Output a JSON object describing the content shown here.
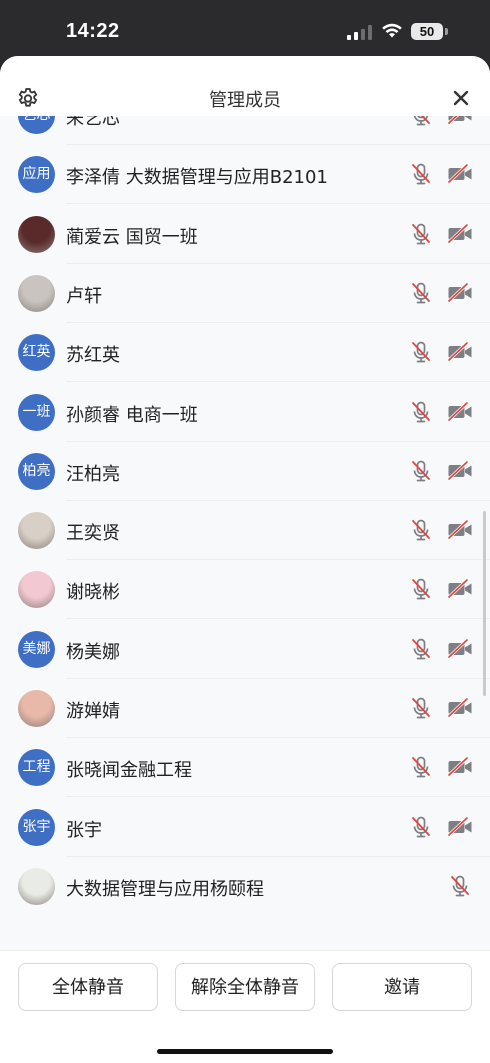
{
  "status_bar": {
    "time": "14:22",
    "battery": "50"
  },
  "header": {
    "title": "管理成员"
  },
  "members": [
    {
      "avatar_text": "艺芯",
      "name": "来艺芯",
      "avatar_type": "text",
      "avatar_color": "#3f6fc4"
    },
    {
      "avatar_text": "应用",
      "name": "李泽倩 大数据管理与应用B2101",
      "avatar_type": "text",
      "avatar_color": "#3f6fc4"
    },
    {
      "avatar_text": "",
      "name": "蔺爱云 国贸一班",
      "avatar_type": "photo",
      "avatar_color": "#5a2a2a"
    },
    {
      "avatar_text": "",
      "name": "卢轩",
      "avatar_type": "photo",
      "avatar_color": "#c9c4bf"
    },
    {
      "avatar_text": "红英",
      "name": "苏红英",
      "avatar_type": "text",
      "avatar_color": "#3f6fc4"
    },
    {
      "avatar_text": "一班",
      "name": "孙颜睿 电商一班",
      "avatar_type": "text",
      "avatar_color": "#3f6fc4"
    },
    {
      "avatar_text": "柏亮",
      "name": "汪柏亮",
      "avatar_type": "text",
      "avatar_color": "#3f6fc4"
    },
    {
      "avatar_text": "",
      "name": "王奕贤",
      "avatar_type": "photo",
      "avatar_color": "#d8cfc6"
    },
    {
      "avatar_text": "",
      "name": "谢晓彬",
      "avatar_type": "photo",
      "avatar_color": "#f2c8d2"
    },
    {
      "avatar_text": "美娜",
      "name": "杨美娜",
      "avatar_type": "text",
      "avatar_color": "#3f6fc4"
    },
    {
      "avatar_text": "",
      "name": "游婵婧",
      "avatar_type": "photo",
      "avatar_color": "#e8b8a8"
    },
    {
      "avatar_text": "工程",
      "name": "张晓闻金融工程",
      "avatar_type": "text",
      "avatar_color": "#3f6fc4"
    },
    {
      "avatar_text": "张宇",
      "name": "张宇",
      "avatar_type": "text",
      "avatar_color": "#3f6fc4"
    },
    {
      "avatar_text": "",
      "name": "大数据管理与应用杨颐程",
      "avatar_type": "photo",
      "avatar_color": "#e9ece6"
    }
  ],
  "footer": {
    "mute_all": "全体静音",
    "unmute_all": "解除全体静音",
    "invite": "邀请"
  },
  "colors": {
    "accent_avatar": "#3f6fc4",
    "muted_icon_red": "#e0463f",
    "icon_gray": "#7d7f85"
  }
}
